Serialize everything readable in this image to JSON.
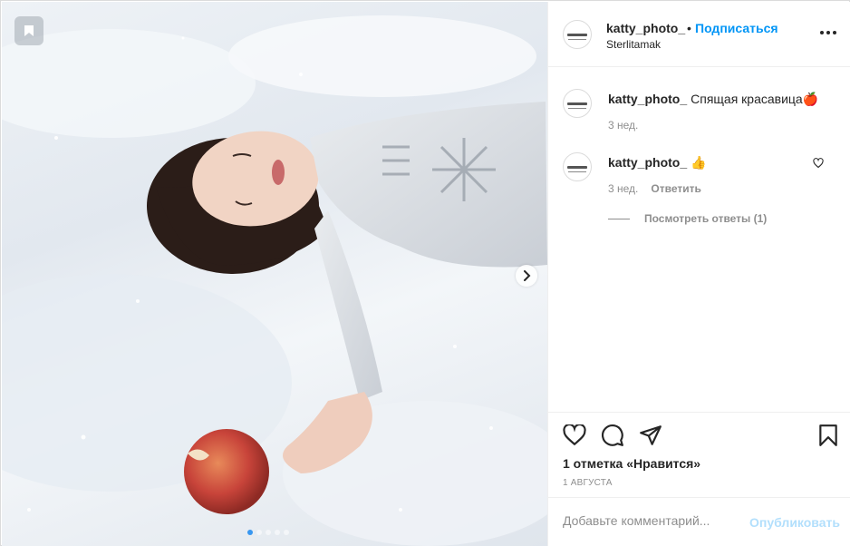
{
  "post": {
    "username": "katty_photo_",
    "separator": "•",
    "follow_label": "Подписаться",
    "location": "Sterlitamak"
  },
  "comments": [
    {
      "username": "katty_photo_",
      "text": "Спящая красавица🍎",
      "time": "3 нед."
    },
    {
      "username": "katty_photo_",
      "text": "👍",
      "time": "3 нед.",
      "reply_label": "Ответить"
    }
  ],
  "view_replies_label": "Посмотреть ответы (1)",
  "likes_text": "1 отметка «Нравится»",
  "date_text": "1 АВГУСТА",
  "comment_box": {
    "placeholder": "Добавьте комментарий...",
    "publish_label": "Опубликовать"
  },
  "carousel": {
    "count": 5,
    "active_index": 0
  },
  "colors": {
    "accent": "#0095f6",
    "publish_disabled": "#b2dffc",
    "secondary_text": "#8e8e8e"
  },
  "icons": [
    "bookmark-icon",
    "chevron-right-icon",
    "more-icon",
    "heart-icon",
    "comment-icon",
    "share-icon",
    "save-icon"
  ]
}
